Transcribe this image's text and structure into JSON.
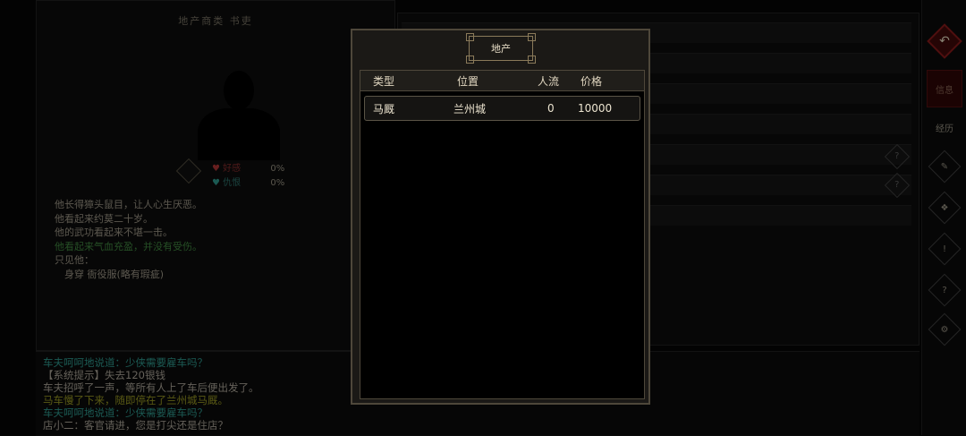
{
  "background": {
    "character": {
      "title": "地产商类  书吏",
      "relations": [
        {
          "label": "好感",
          "value": "0%",
          "heart_color": "#a03030"
        },
        {
          "label": "仇恨",
          "value": "0%",
          "heart_color": "#2a8a80"
        }
      ],
      "description": [
        {
          "text": "他长得獐头鼠目，让人心生厌恶。",
          "color": "white"
        },
        {
          "text": "他看起来约莫二十岁。",
          "color": "white"
        },
        {
          "text": "他的武功看起来不堪一击。",
          "color": "white"
        },
        {
          "text": "他看起来气血充盈，并没有受伤。",
          "color": "green"
        },
        {
          "text": "只见他：",
          "color": "white"
        },
        {
          "text": "　身穿 衙役服(略有瑕疵)",
          "color": "white"
        }
      ]
    },
    "sidebar": {
      "info_label": "信息",
      "record_label": "经历"
    },
    "log": [
      {
        "text": "车夫呵呵地说道：少侠需要雇车吗？",
        "color": "teal"
      },
      {
        "text": "【系统提示】失去120银钱",
        "color": "white"
      },
      {
        "text": "车夫招呼了一声，等所有人上了车后便出发了。",
        "color": "white"
      },
      {
        "text": "马车慢了下来，随即停在了兰州城马厩。",
        "color": "yellow"
      },
      {
        "text": "车夫呵呵地说道：少侠需要雇车吗？",
        "color": "teal"
      },
      {
        "text": "店小二：客官请进，您是打尖还是住店？",
        "color": "white"
      }
    ]
  },
  "modal": {
    "title": "地产",
    "columns": [
      "类型",
      "位置",
      "人流",
      "价格"
    ],
    "rows": [
      {
        "type": "马厩",
        "location": "兰州城",
        "traffic": "0",
        "price": "10000"
      }
    ]
  }
}
